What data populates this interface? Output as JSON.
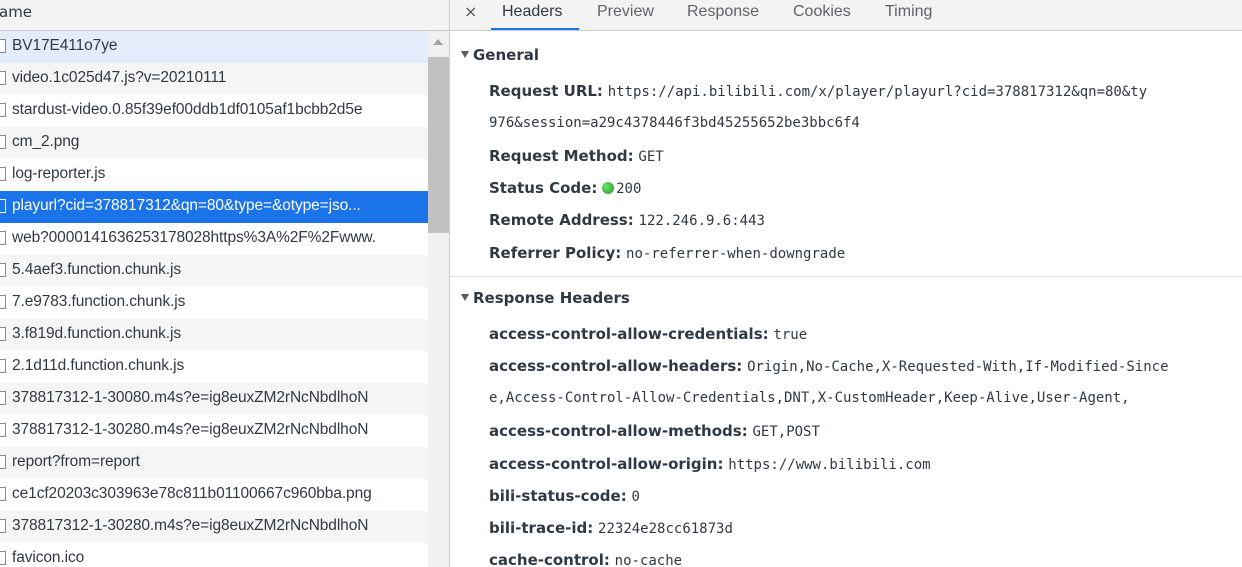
{
  "list": {
    "header": "ame",
    "rows": [
      "BV17E411o7ye",
      "video.1c025d47.js?v=20210111",
      "stardust-video.0.85f39ef00ddb1df0105af1bcbb2d5e",
      "cm_2.png",
      "log-reporter.js",
      "playurl?cid=378817312&qn=80&type=&otype=jso...",
      "web?0000141636253178028https%3A%2F%2Fwww.",
      "5.4aef3.function.chunk.js",
      "7.e9783.function.chunk.js",
      "3.f819d.function.chunk.js",
      "2.1d11d.function.chunk.js",
      "378817312-1-30080.m4s?e=ig8euxZM2rNcNbdlhoN",
      "378817312-1-30280.m4s?e=ig8euxZM2rNcNbdlhoN",
      "report?from=report",
      "ce1cf20203c303963e78c811b01100667c960bba.png",
      "378817312-1-30280.m4s?e=ig8euxZM2rNcNbdlhoN",
      "favicon.ico"
    ]
  },
  "tabs": {
    "close": "×",
    "items": [
      "Headers",
      "Preview",
      "Response",
      "Cookies",
      "Timing"
    ],
    "active": "Headers"
  },
  "general": {
    "title": "General",
    "request_url_label": "Request URL:",
    "request_url_value": "https://api.bilibili.com/x/player/playurl?cid=378817312&qn=80&ty",
    "request_url_cont": "976&session=a29c4378446f3bd45255652be3bbc6f4",
    "method_label": "Request Method:",
    "method_value": "GET",
    "status_label": "Status Code:",
    "status_value": "200",
    "remote_label": "Remote Address:",
    "remote_value": "122.246.9.6:443",
    "referrer_label": "Referrer Policy:",
    "referrer_value": "no-referrer-when-downgrade"
  },
  "response_headers": {
    "title": "Response Headers",
    "acac_label": "access-control-allow-credentials:",
    "acac_value": "true",
    "acah_label": "access-control-allow-headers:",
    "acah_value": "Origin,No-Cache,X-Requested-With,If-Modified-Since",
    "acah_cont": "e,Access-Control-Allow-Credentials,DNT,X-CustomHeader,Keep-Alive,User-Agent,",
    "acam_label": "access-control-allow-methods:",
    "acam_value": "GET,POST",
    "acao_label": "access-control-allow-origin:",
    "acao_value": "https://www.bilibili.com",
    "bsc_label": "bili-status-code:",
    "bsc_value": "0",
    "bti_label": "bili-trace-id:",
    "bti_value": "22324e28cc61873d",
    "cc_label": "cache-control:",
    "cc_value": "no-cache"
  },
  "colors": {
    "accent": "#1a73e8",
    "status_ok": "#2fb52f"
  }
}
